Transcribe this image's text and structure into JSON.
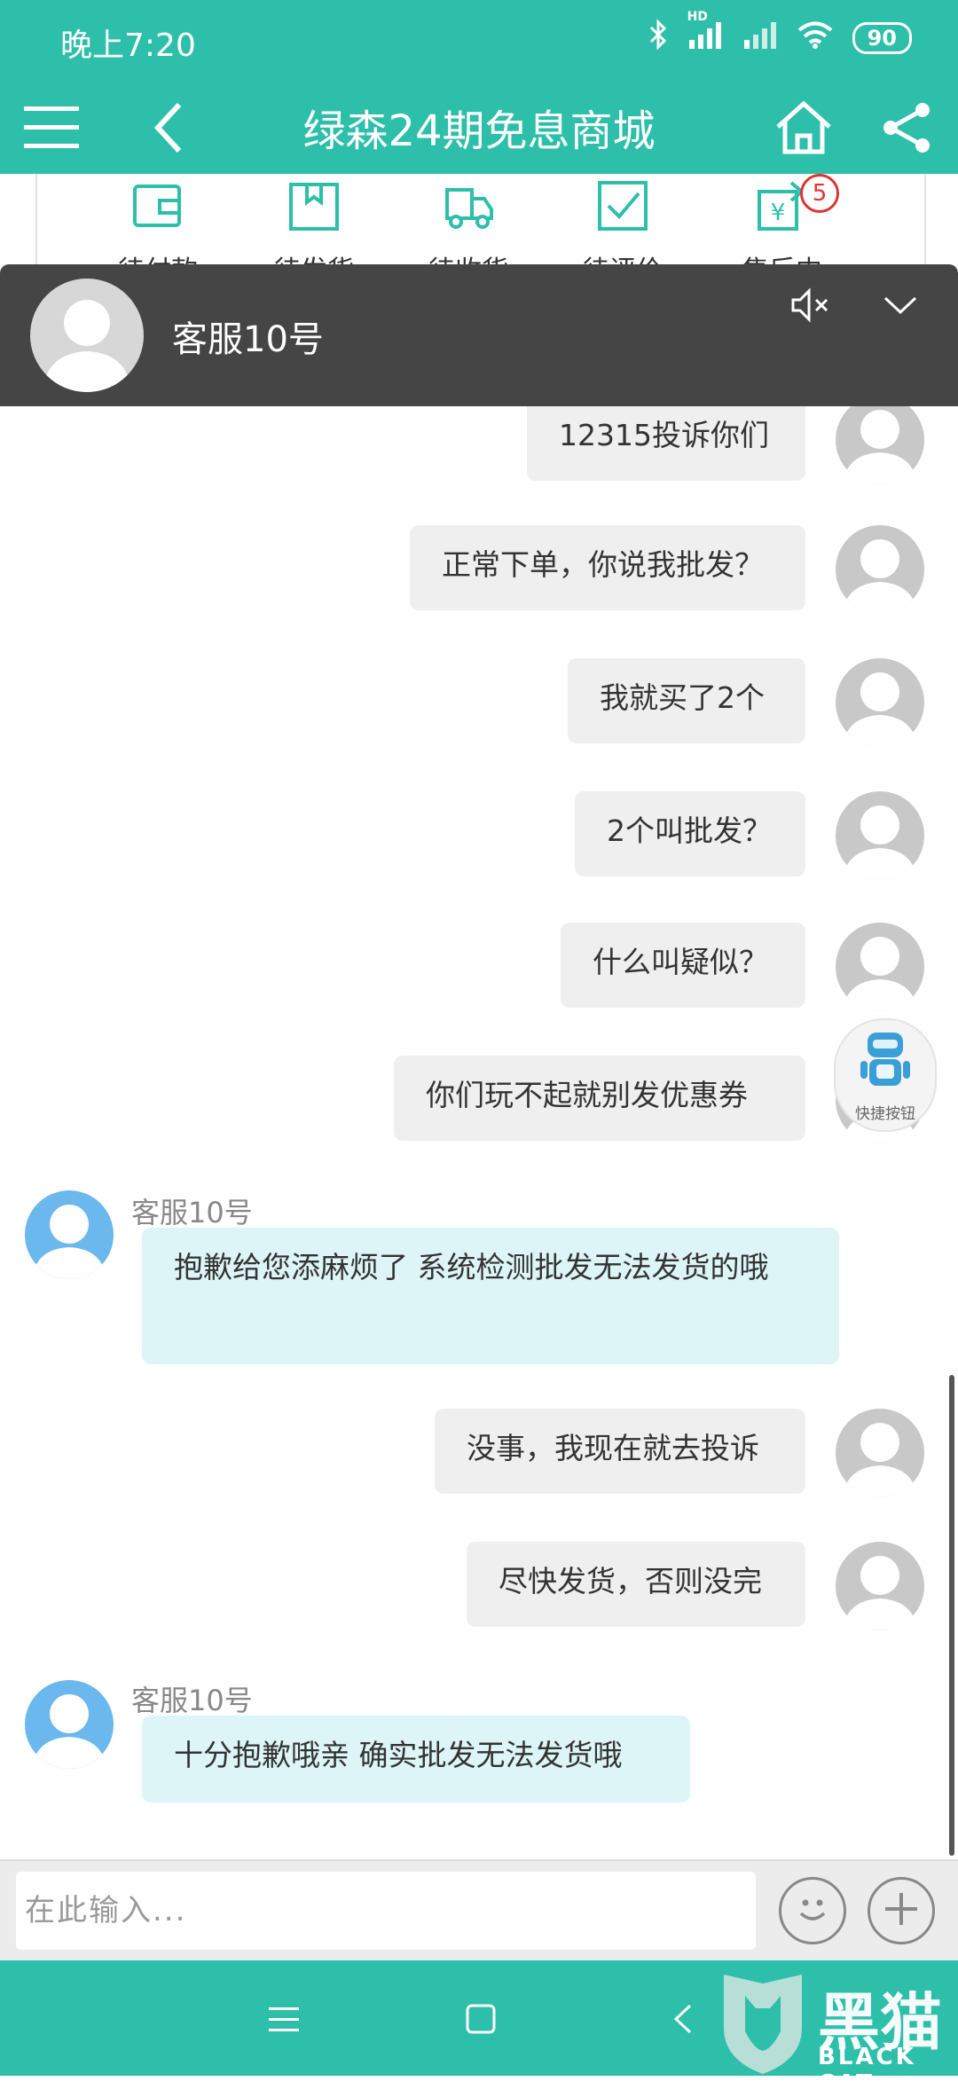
{
  "status_bar": {
    "time": "晚上7:20",
    "network": "HD",
    "battery": "90"
  },
  "header": {
    "title": "绿森24期免息商城"
  },
  "order_strip": {
    "items": [
      {
        "label": "待付款",
        "icon": "wallet-icon"
      },
      {
        "label": "待发货",
        "icon": "package-icon"
      },
      {
        "label": "待收货",
        "icon": "truck-icon"
      },
      {
        "label": "待评价",
        "icon": "check-icon"
      },
      {
        "label": "售后中",
        "icon": "refund-icon",
        "badge": "5"
      }
    ]
  },
  "agent": {
    "name": "客服10号"
  },
  "messages": [
    {
      "side": "out",
      "text": "12315投诉你们"
    },
    {
      "side": "out",
      "text": "正常下单，你说我批发？"
    },
    {
      "side": "out",
      "text": "我就买了2个"
    },
    {
      "side": "out",
      "text": "2个叫批发？"
    },
    {
      "side": "out",
      "text": "什么叫疑似？"
    },
    {
      "side": "out",
      "text": "你们玩不起就别发优惠券"
    },
    {
      "side": "in",
      "sender": "客服10号",
      "text": "抱歉给您添麻烦了 系统检测批发无法发货的哦"
    },
    {
      "side": "out",
      "text": "没事，我现在就去投诉"
    },
    {
      "side": "out",
      "text": "尽快发货，否则没完"
    },
    {
      "side": "in",
      "sender": "客服10号",
      "text": "十分抱歉哦亲 确实批发无法发货哦"
    }
  ],
  "quick_button": {
    "label": "快捷按钮"
  },
  "input": {
    "placeholder": "在此输入...",
    "value": ""
  },
  "watermark": {
    "text": "黑猫",
    "sub": "BLACK CAT"
  }
}
